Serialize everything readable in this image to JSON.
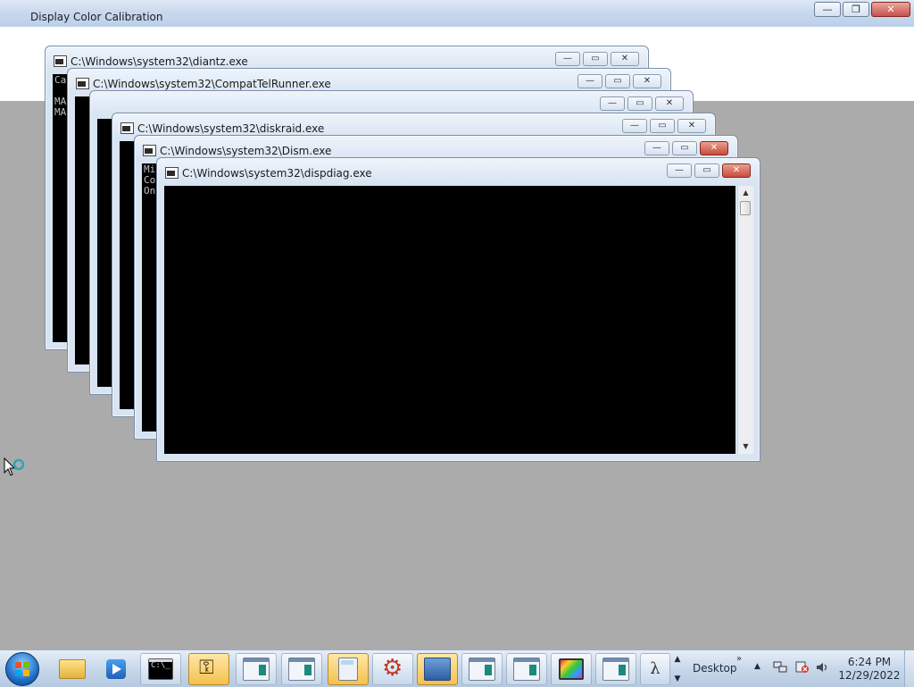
{
  "background_window": {
    "title": "Display Color Calibration",
    "buttons": {
      "minimize": "—",
      "restore": "❐",
      "close": "✕"
    }
  },
  "windows": [
    {
      "title": "C:\\Windows\\system32\\diantz.exe",
      "console_text": "Ca\n\nMA\nMA"
    },
    {
      "title": "C:\\Windows\\system32\\CompatTelRunner.exe",
      "console_text": ""
    },
    {
      "title": "",
      "console_text": ""
    },
    {
      "title": "C:\\Windows\\system32\\diskraid.exe",
      "console_text": ""
    },
    {
      "title": "C:\\Windows\\system32\\Dism.exe",
      "console_text": "Mi\nCo\nOn"
    },
    {
      "title": "C:\\Windows\\system32\\dispdiag.exe",
      "console_text": ""
    }
  ],
  "window_buttons": {
    "minimize": "—",
    "restore": "▭",
    "close": "✕"
  },
  "taskbar": {
    "items": [
      {
        "name": "explorer-taskbar-button",
        "icon": "folder-icon"
      },
      {
        "name": "media-player-taskbar-button",
        "icon": "media-player-icon"
      },
      {
        "name": "cmd-taskbar-button",
        "icon": "command-prompt-icon",
        "icon_text": "C:\\_"
      },
      {
        "name": "credential-taskbar-button",
        "icon": "keys-icon"
      },
      {
        "name": "console-window-taskbar-button-1",
        "icon": "console-window-icon"
      },
      {
        "name": "console-window-taskbar-button-2",
        "icon": "console-window-icon"
      },
      {
        "name": "calculator-taskbar-button",
        "icon": "calculator-icon"
      },
      {
        "name": "system-tool-taskbar-button",
        "icon": "gear-icon"
      },
      {
        "name": "network-taskbar-button",
        "icon": "network-icon"
      },
      {
        "name": "console-window-taskbar-button-3",
        "icon": "console-window-icon"
      },
      {
        "name": "console-window-taskbar-button-4",
        "icon": "console-window-icon"
      },
      {
        "name": "color-calibration-taskbar-button",
        "icon": "monitor-icon"
      },
      {
        "name": "console-window-taskbar-button-5",
        "icon": "console-window-icon"
      },
      {
        "name": "lambda-taskbar-button",
        "icon": "lambda-icon",
        "icon_text": "λ"
      }
    ],
    "overflow": "»",
    "desktop_label": "Desktop",
    "desktop_chevron": "»",
    "tray_up": "▲",
    "clock_time": "6:24 PM",
    "clock_date": "12/29/2022"
  }
}
